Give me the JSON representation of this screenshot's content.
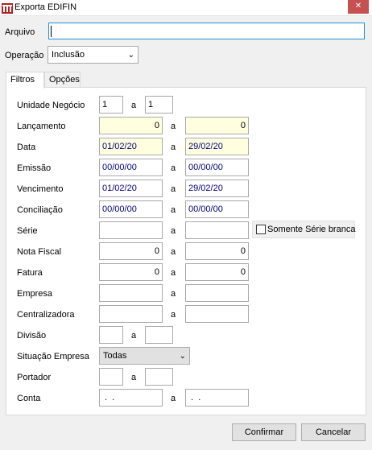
{
  "window": {
    "title": "Exporta EDIFIN",
    "close_glyph": "✕",
    "icon": "app-logo-icon",
    "close_color": "#c75050"
  },
  "arquivo": {
    "label": "Arquivo",
    "value": ""
  },
  "operacao": {
    "label": "Operação",
    "value": "Inclusão"
  },
  "tabs": [
    {
      "label": "Filtros",
      "active": true
    },
    {
      "label": "Opções",
      "active": false
    }
  ],
  "filters": {
    "range_sep": "a",
    "unidade": {
      "label": "Unidade Negócio",
      "from": "1",
      "to": "1"
    },
    "lancamento": {
      "label": "Lançamento",
      "from": "0",
      "to": "0"
    },
    "data": {
      "label": "Data",
      "from": "01/02/20",
      "to": "29/02/20"
    },
    "emissao": {
      "label": "Emissão",
      "from": "00/00/00",
      "to": "00/00/00"
    },
    "vencimento": {
      "label": "Vencimento",
      "from": "01/02/20",
      "to": "29/02/20"
    },
    "conciliacao": {
      "label": "Conciliação",
      "from": "00/00/00",
      "to": "00/00/00"
    },
    "serie": {
      "label": "Série",
      "from": "",
      "to": "",
      "checkbox_label": "Somente Série branca",
      "checked": false
    },
    "nota_fiscal": {
      "label": "Nota Fiscal",
      "from": "0",
      "to": "0"
    },
    "fatura": {
      "label": "Fatura",
      "from": "0",
      "to": "0"
    },
    "empresa": {
      "label": "Empresa",
      "from": "",
      "to": ""
    },
    "centralizadora": {
      "label": "Centralizadora",
      "from": "",
      "to": ""
    },
    "divisao": {
      "label": "Divisão",
      "from": "",
      "to": ""
    },
    "situacao_empresa": {
      "label": "Situação Empresa",
      "value": "Todas"
    },
    "portador": {
      "label": "Portador",
      "from": "",
      "to": ""
    },
    "conta": {
      "label": "Conta",
      "from": " .  .",
      "to": " .  ."
    }
  },
  "buttons": {
    "confirmar": "Confirmar",
    "cancelar": "Cancelar"
  },
  "colors": {
    "highlight_field": "#ffffe0",
    "date_text": "#000080",
    "focus_border": "#1e8fd8"
  }
}
